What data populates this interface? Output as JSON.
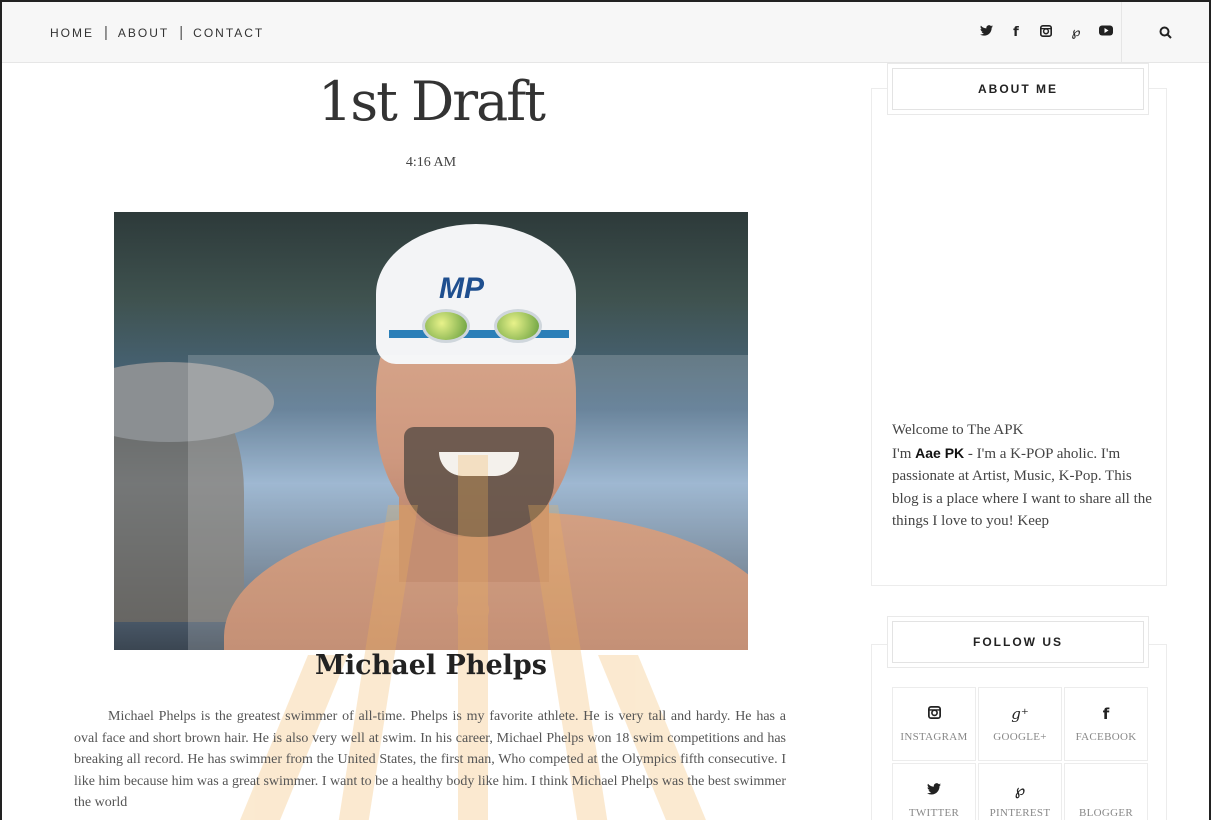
{
  "nav": {
    "items": [
      {
        "label": "HOME"
      },
      {
        "label": "ABOUT"
      },
      {
        "label": "CONTACT"
      }
    ],
    "separator": "|"
  },
  "social": {
    "icons": [
      "twitter-icon",
      "facebook-icon",
      "instagram-icon",
      "pinterest-icon",
      "youtube-icon"
    ],
    "glyphs": {
      "twitter": "🐦",
      "facebook": "f",
      "instagram": "◙",
      "pinterest": "℘",
      "youtube": "▶"
    }
  },
  "post": {
    "title": "1st Draft",
    "time": "4:16 AM",
    "image_subject": "Michael Phelps",
    "cap_logo": "MP",
    "heading": "Michael Phelps",
    "body": "Michael Phelps is the greatest swimmer of all-time. Phelps is my favorite athlete. He is very tall and hardy. He has a oval face and short brown hair. He is also very well at swim. In his career, Michael Phelps won 18 swim competitions and has breaking all record. He has swimmer from the United States, the first man, Who competed at the Olympics fifth consecutive. I like him because him was a great swimmer. I want to be a healthy body like him. I think Michael Phelps was the best swimmer the world"
  },
  "sidebar": {
    "about": {
      "title": "ABOUT ME",
      "welcome": "Welcome to The APK",
      "im": "I'm ",
      "name": "Aae PK",
      "rest": " - I'm a K-POP aholic. I'm passionate at Artist, Music, K-Pop. This blog is a place where I want to share all the things I love to you! Keep"
    },
    "follow": {
      "title": "FOLLOW US",
      "items": [
        {
          "label": "INSTAGRAM",
          "icon": "◙"
        },
        {
          "label": "GOOGLE+",
          "icon": "g+"
        },
        {
          "label": "FACEBOOK",
          "icon": "f"
        },
        {
          "label": "TWITTER",
          "icon": "🐦"
        },
        {
          "label": "PINTEREST",
          "icon": "℘"
        },
        {
          "label": "BLOGGER",
          "icon": ""
        }
      ]
    }
  },
  "colors": {
    "text": "#333333",
    "muted": "#888888",
    "border": "#ececec",
    "topbar": "#f7f7f7"
  }
}
